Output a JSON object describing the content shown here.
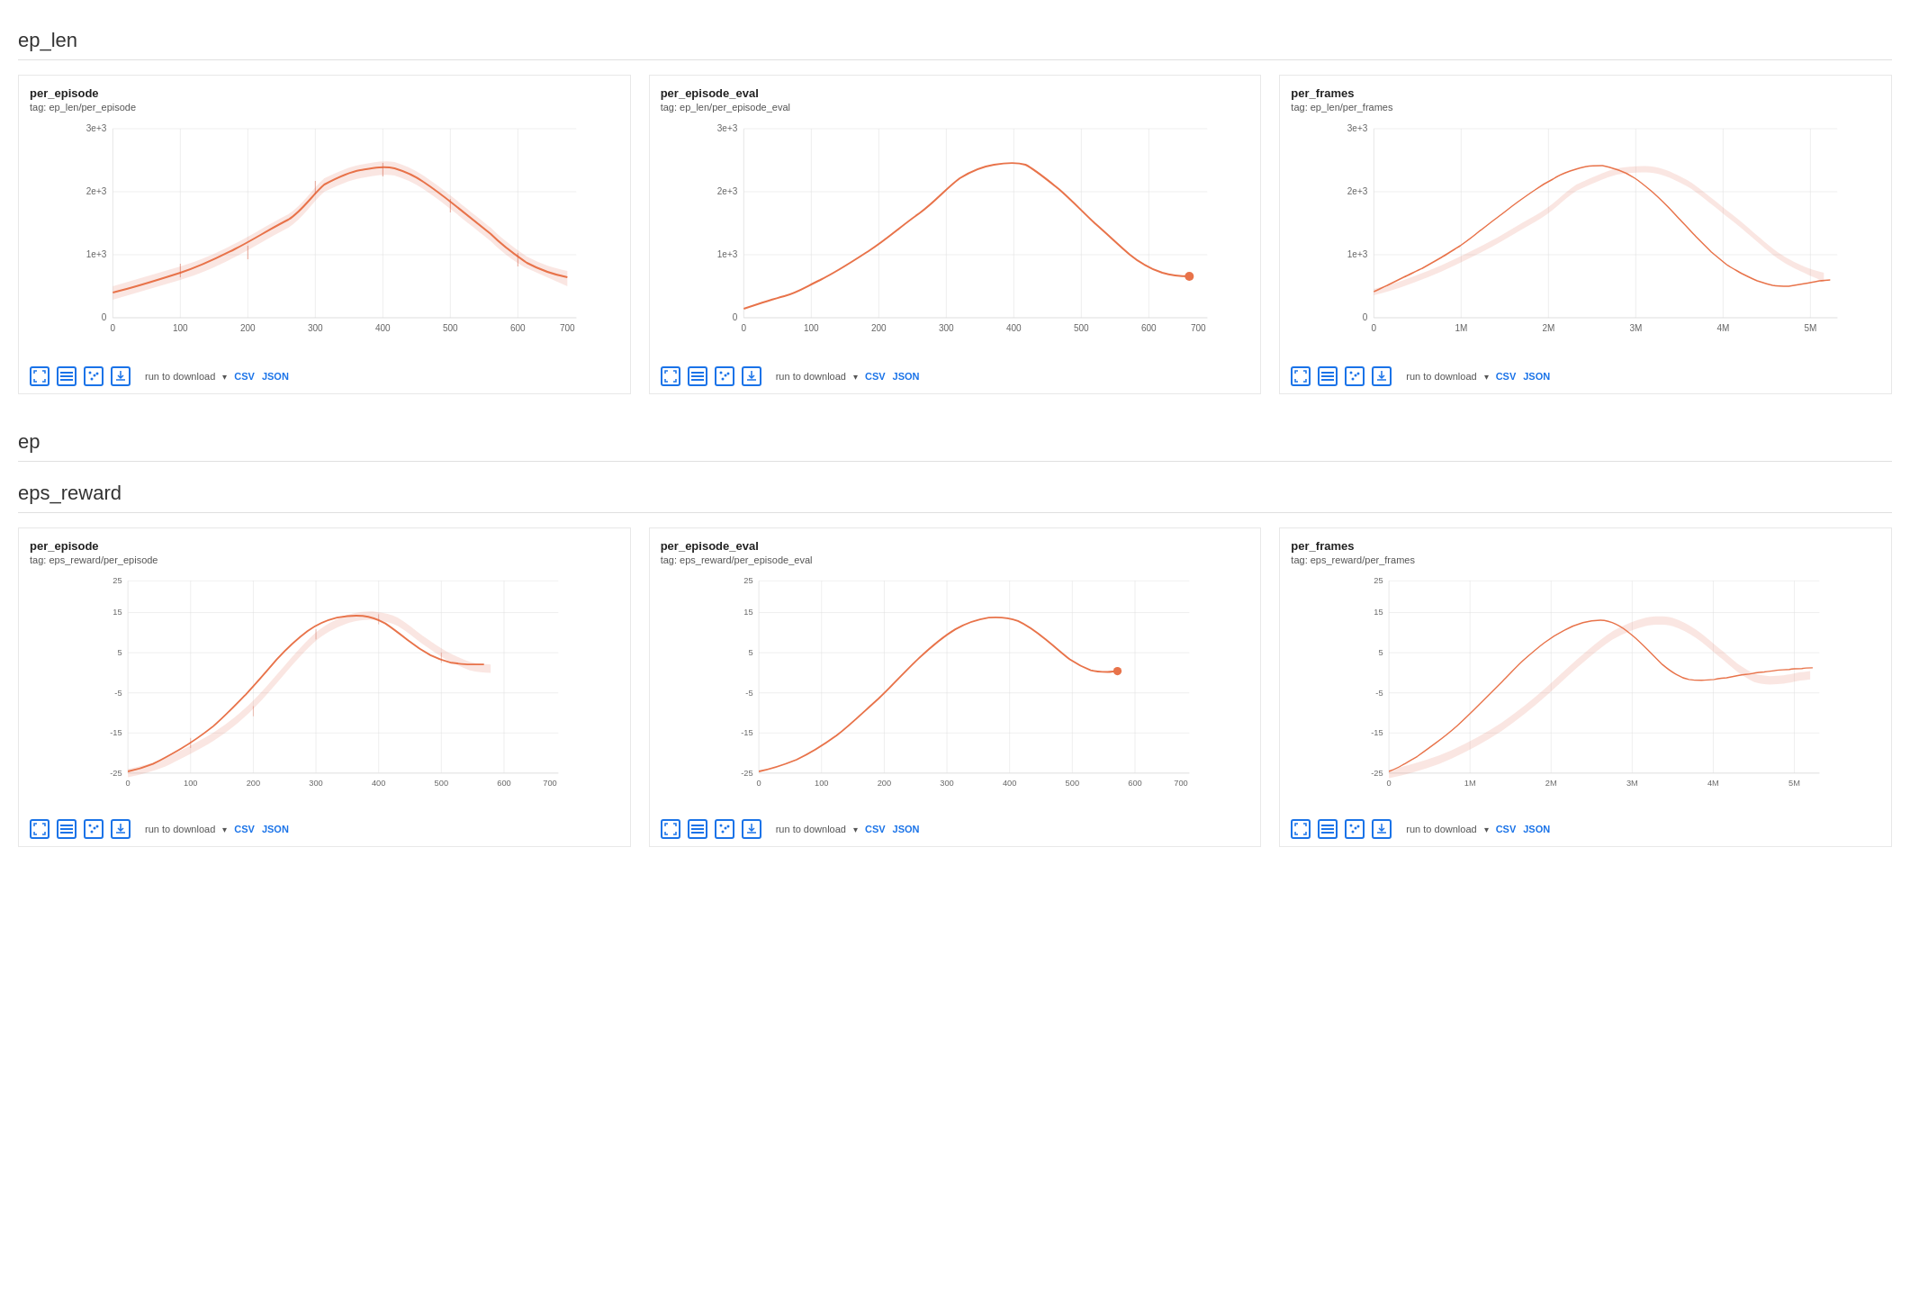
{
  "sections": [
    {
      "id": "ep_len",
      "label": "ep_len",
      "charts": [
        {
          "id": "ep_len_per_episode",
          "title": "per_episode",
          "tag": "tag: ep_len/per_episode",
          "xLabels": [
            "0",
            "100",
            "200",
            "300",
            "400",
            "500",
            "600",
            "700"
          ],
          "yLabels": [
            "0",
            "1e+3",
            "2e+3",
            "3e+3"
          ],
          "type": "ep_len_episode"
        },
        {
          "id": "ep_len_per_episode_eval",
          "title": "per_episode_eval",
          "tag": "tag: ep_len/per_episode_eval",
          "xLabels": [
            "0",
            "100",
            "200",
            "300",
            "400",
            "500",
            "600",
            "700"
          ],
          "yLabels": [
            "0",
            "1e+3",
            "2e+3",
            "3e+3"
          ],
          "type": "ep_len_eval"
        },
        {
          "id": "ep_len_per_frames",
          "title": "per_frames",
          "tag": "tag: ep_len/per_frames",
          "xLabels": [
            "0",
            "1M",
            "2M",
            "3M",
            "4M",
            "5M"
          ],
          "yLabels": [
            "0",
            "1e+3",
            "2e+3",
            "3e+3"
          ],
          "type": "ep_len_frames"
        }
      ]
    }
  ],
  "ep_section_label": "ep",
  "eps_reward_section_label": "eps_reward",
  "sections2": [
    {
      "id": "eps_reward",
      "charts": [
        {
          "id": "eps_reward_per_episode",
          "title": "per_episode",
          "tag": "tag: eps_reward/per_episode",
          "xLabels": [
            "0",
            "100",
            "200",
            "300",
            "400",
            "500",
            "600",
            "700"
          ],
          "yLabels": [
            "-25",
            "-15",
            "-5",
            "5",
            "15",
            "25"
          ],
          "type": "eps_reward_episode"
        },
        {
          "id": "eps_reward_per_episode_eval",
          "title": "per_episode_eval",
          "tag": "tag: eps_reward/per_episode_eval",
          "xLabels": [
            "0",
            "100",
            "200",
            "300",
            "400",
            "500",
            "600",
            "700"
          ],
          "yLabels": [
            "-25",
            "-15",
            "-5",
            "5",
            "15",
            "25"
          ],
          "type": "eps_reward_eval"
        },
        {
          "id": "eps_reward_per_frames",
          "title": "per_frames",
          "tag": "tag: eps_reward/per_frames",
          "xLabels": [
            "0",
            "1M",
            "2M",
            "3M",
            "4M",
            "5M"
          ],
          "yLabels": [
            "-25",
            "-15",
            "-5",
            "5",
            "15",
            "25"
          ],
          "type": "eps_reward_frames"
        }
      ]
    }
  ],
  "toolbar": {
    "run_to_download": "run to download",
    "csv_label": "CSV",
    "json_label": "JSON",
    "dropdown_arrow": "▾"
  }
}
